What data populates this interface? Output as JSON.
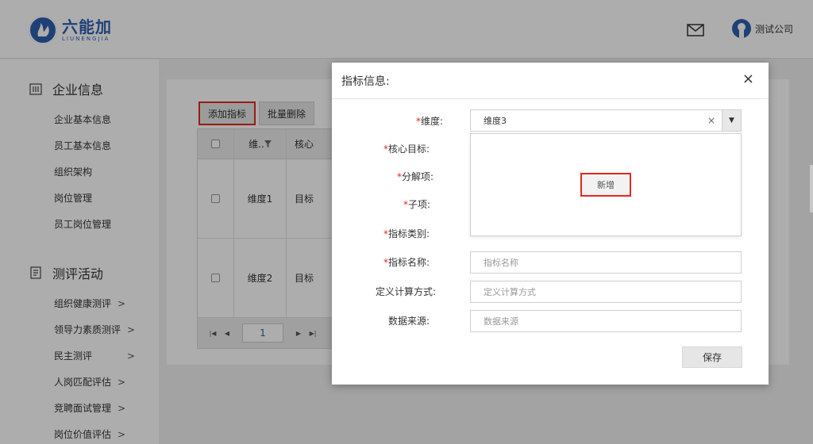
{
  "header": {
    "logo_cn": "六能加",
    "logo_en": "LIUNENGJIA",
    "user_name": "测试公司"
  },
  "sidebar": {
    "group1": {
      "title": "企业信息",
      "items": [
        "企业基本信息",
        "员工基本信息",
        "组织架构",
        "岗位管理",
        "员工岗位管理"
      ]
    },
    "group2": {
      "title": "测评活动",
      "items": [
        "组织健康测评",
        "领导力素质测评",
        "民主测评",
        "人岗匹配评估",
        "竞聘面试管理",
        "岗位价值评估"
      ]
    },
    "chevron": ">"
  },
  "toolbar": {
    "add_label": "添加指标",
    "batch_delete_label": "批量删除"
  },
  "table": {
    "headers": [
      "维..",
      "核心"
    ],
    "rows": [
      {
        "dimension": "维度1",
        "core": "目标"
      },
      {
        "dimension": "维度2",
        "core": "目标"
      }
    ],
    "page": "1"
  },
  "modal": {
    "title": "指标信息:",
    "close": "×",
    "labels": {
      "dimension": "维度:",
      "core_goal": "核心目标:",
      "breakdown": "分解项:",
      "sub_item": "子项:",
      "category": "指标类别:",
      "name": "指标名称:",
      "calc": "定义计算方式:",
      "source": "数据来源:"
    },
    "required_mark": "*",
    "dimension_value": "维度3",
    "clear": "×",
    "new_label": "新增",
    "placeholders": {
      "name": "指标名称",
      "calc": "定义计算方式",
      "source": "数据来源"
    },
    "save_label": "保存"
  },
  "colors": {
    "brand": "#2d5fb0",
    "highlight": "#e02a1e"
  }
}
